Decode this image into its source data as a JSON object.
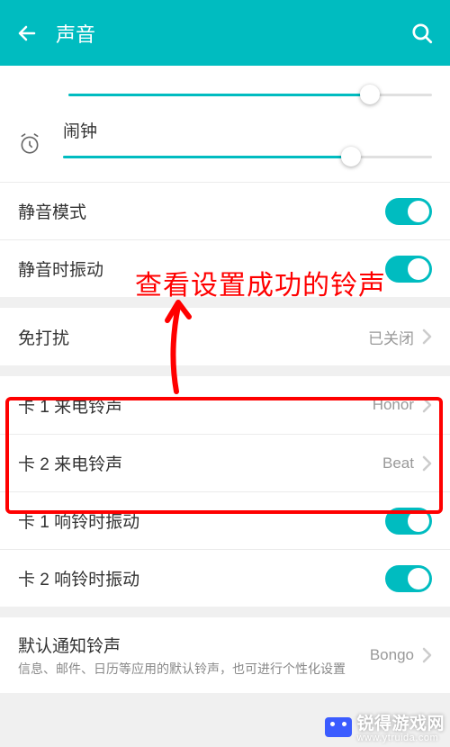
{
  "header": {
    "title": "声音"
  },
  "sliders": {
    "alarm": {
      "label": "闹钟",
      "value_pct": 78
    },
    "top": {
      "value_pct": 83
    }
  },
  "toggles": {
    "silent_mode": {
      "label": "静音模式",
      "on": true
    },
    "vibrate_silent": {
      "label": "静音时振动",
      "on": true
    },
    "sim1_vibrate": {
      "label": "卡 1 响铃时振动",
      "on": true
    },
    "sim2_vibrate": {
      "label": "卡 2 响铃时振动",
      "on": true
    }
  },
  "rows": {
    "dnd": {
      "label": "免打扰",
      "value": "已关闭"
    },
    "sim1_ring": {
      "label": "卡 1 来电铃声",
      "value": "Honor"
    },
    "sim2_ring": {
      "label": "卡 2 来电铃声",
      "value": "Beat"
    },
    "default_notif": {
      "label": "默认通知铃声",
      "sub": "信息、邮件、日历等应用的默认铃声，也可进行个性化设置",
      "value": "Bongo"
    }
  },
  "annotation": {
    "text": "查看设置成功的铃声"
  },
  "watermark": {
    "main": "锐得游戏网",
    "sub": "www.ytruida.com"
  }
}
